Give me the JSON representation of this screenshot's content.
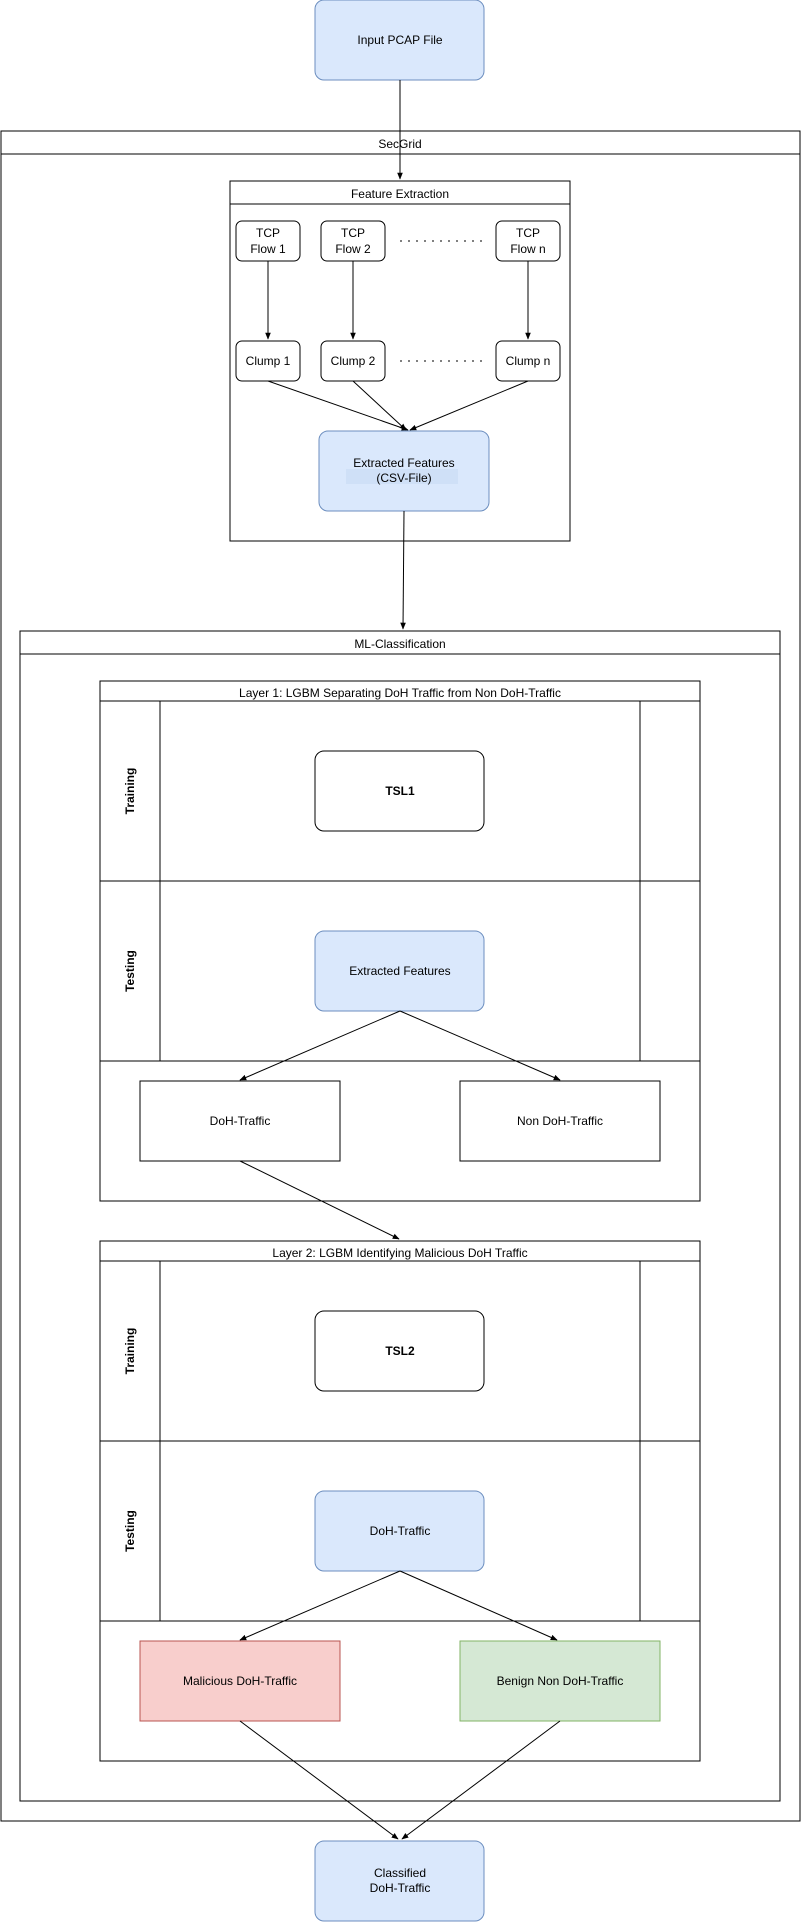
{
  "input_node": "Input PCAP File",
  "secgrid_title": "SecGrid",
  "feature_extraction": {
    "title": "Feature Extraction",
    "flows": [
      {
        "line1": "TCP",
        "line2": "Flow 1"
      },
      {
        "line1": "TCP",
        "line2": "Flow 2"
      },
      {
        "line1": "TCP",
        "line2": "Flow n"
      }
    ],
    "clumps": [
      "Clump 1",
      "Clump 2",
      "Clump n"
    ],
    "extracted": {
      "line1": "Extracted Features",
      "line2": "(CSV-File)"
    }
  },
  "ml_classification": {
    "title": "ML-Classification",
    "layer1": {
      "title": "Layer 1: LGBM Separating DoH Traffic from Non DoH-Traffic",
      "training_label": "Training",
      "testing_label": "Testing",
      "training_node": "TSL1",
      "testing_node": "Extracted Features",
      "out_left": "DoH-Traffic",
      "out_right": "Non DoH-Traffic"
    },
    "layer2": {
      "title": "Layer 2: LGBM Identifying Malicious DoH Traffic",
      "training_label": "Training",
      "testing_label": "Testing",
      "training_node": "TSL2",
      "testing_node": "DoH-Traffic",
      "out_left": "Malicious DoH-Traffic",
      "out_right": "Benign Non DoH-Traffic"
    }
  },
  "output_node": {
    "line1": "Classified",
    "line2": "DoH-Traffic"
  },
  "colors": {
    "blue_fill": "#dae8fc",
    "blue_stroke": "#6c8ebf",
    "red_fill": "#f8cecc",
    "red_stroke": "#b85450",
    "green_fill": "#d5e8d4",
    "green_stroke": "#82b366",
    "line": "#000000"
  }
}
